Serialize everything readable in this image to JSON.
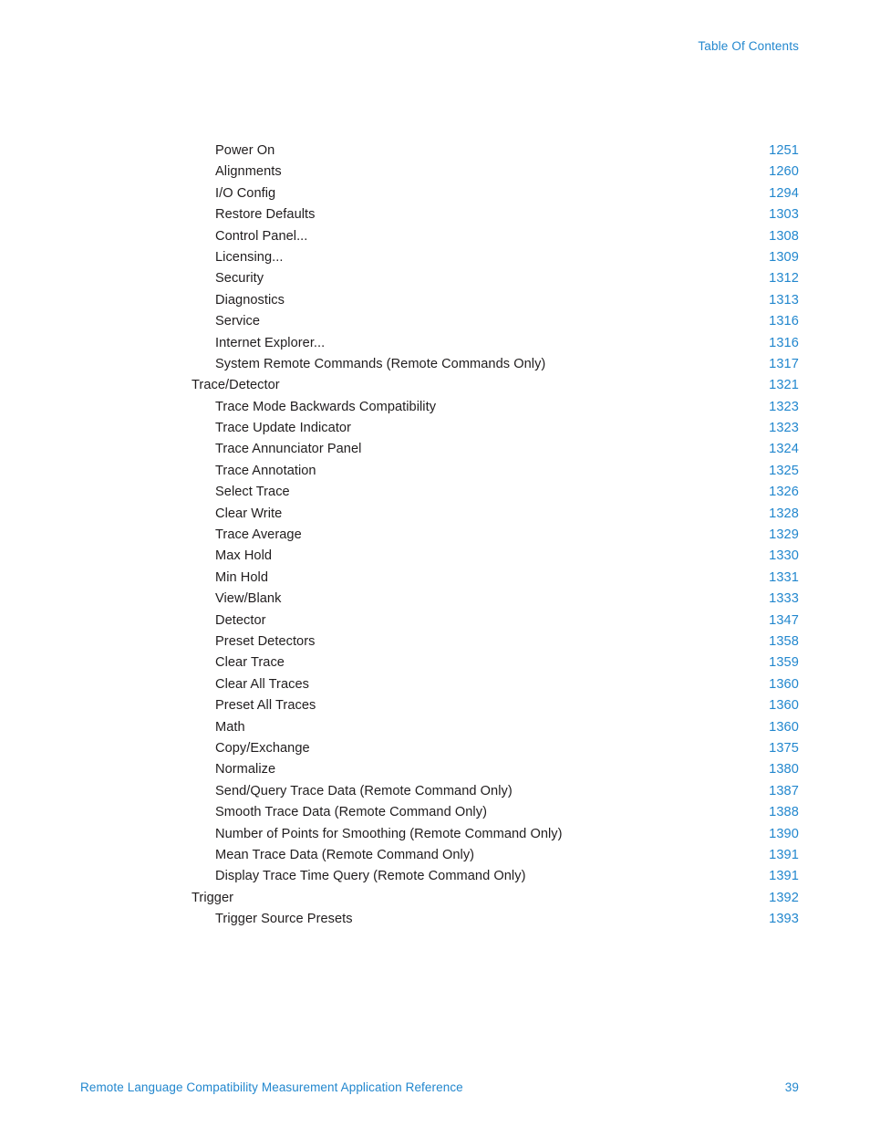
{
  "header": {
    "title": "Table Of Contents"
  },
  "accent_color": "#2287ce",
  "body_text_color": "#201d1e",
  "toc": {
    "entries": [
      {
        "title": "Power On",
        "page": "1251",
        "level": 2
      },
      {
        "title": "Alignments",
        "page": "1260",
        "level": 2
      },
      {
        "title": "I/O Config",
        "page": "1294",
        "level": 2
      },
      {
        "title": "Restore Defaults",
        "page": "1303",
        "level": 2
      },
      {
        "title": "Control Panel...",
        "page": "1308",
        "level": 2
      },
      {
        "title": "Licensing...",
        "page": "1309",
        "level": 2
      },
      {
        "title": "Security",
        "page": "1312",
        "level": 2
      },
      {
        "title": "Diagnostics",
        "page": "1313",
        "level": 2
      },
      {
        "title": "Service",
        "page": "1316",
        "level": 2
      },
      {
        "title": "Internet Explorer...",
        "page": "1316",
        "level": 2
      },
      {
        "title": "System Remote Commands (Remote Commands Only)",
        "page": "1317",
        "level": 2
      },
      {
        "title": "Trace/Detector",
        "page": "1321",
        "level": 1
      },
      {
        "title": "Trace Mode Backwards Compatibility",
        "page": "1323",
        "level": 2
      },
      {
        "title": "Trace Update Indicator",
        "page": "1323",
        "level": 2
      },
      {
        "title": "Trace Annunciator Panel",
        "page": "1324",
        "level": 2
      },
      {
        "title": "Trace Annotation",
        "page": "1325",
        "level": 2
      },
      {
        "title": "Select Trace",
        "page": "1326",
        "level": 2
      },
      {
        "title": "Clear Write",
        "page": "1328",
        "level": 2
      },
      {
        "title": "Trace Average",
        "page": "1329",
        "level": 2
      },
      {
        "title": "Max Hold",
        "page": "1330",
        "level": 2
      },
      {
        "title": "Min Hold",
        "page": "1331",
        "level": 2
      },
      {
        "title": "View/Blank",
        "page": "1333",
        "level": 2
      },
      {
        "title": "Detector",
        "page": "1347",
        "level": 2
      },
      {
        "title": "Preset Detectors",
        "page": "1358",
        "level": 2
      },
      {
        "title": "Clear Trace",
        "page": "1359",
        "level": 2
      },
      {
        "title": "Clear All Traces",
        "page": "1360",
        "level": 2
      },
      {
        "title": "Preset All Traces",
        "page": "1360",
        "level": 2
      },
      {
        "title": "Math",
        "page": "1360",
        "level": 2
      },
      {
        "title": "Copy/Exchange",
        "page": "1375",
        "level": 2
      },
      {
        "title": "Normalize",
        "page": "1380",
        "level": 2
      },
      {
        "title": "Send/Query Trace Data (Remote Command Only)",
        "page": "1387",
        "level": 2
      },
      {
        "title": "Smooth Trace Data (Remote Command Only)",
        "page": "1388",
        "level": 2
      },
      {
        "title": "Number of Points for Smoothing (Remote Command Only)",
        "page": "1390",
        "level": 2
      },
      {
        "title": "Mean Trace Data (Remote Command Only)",
        "page": "1391",
        "level": 2
      },
      {
        "title": "Display Trace Time Query (Remote Command Only)",
        "page": "1391",
        "level": 2
      },
      {
        "title": "Trigger",
        "page": "1392",
        "level": 1
      },
      {
        "title": "Trigger Source Presets",
        "page": "1393",
        "level": 2
      }
    ]
  },
  "footer": {
    "document_title": "Remote Language Compatibility Measurement Application Reference",
    "page_number": "39"
  }
}
